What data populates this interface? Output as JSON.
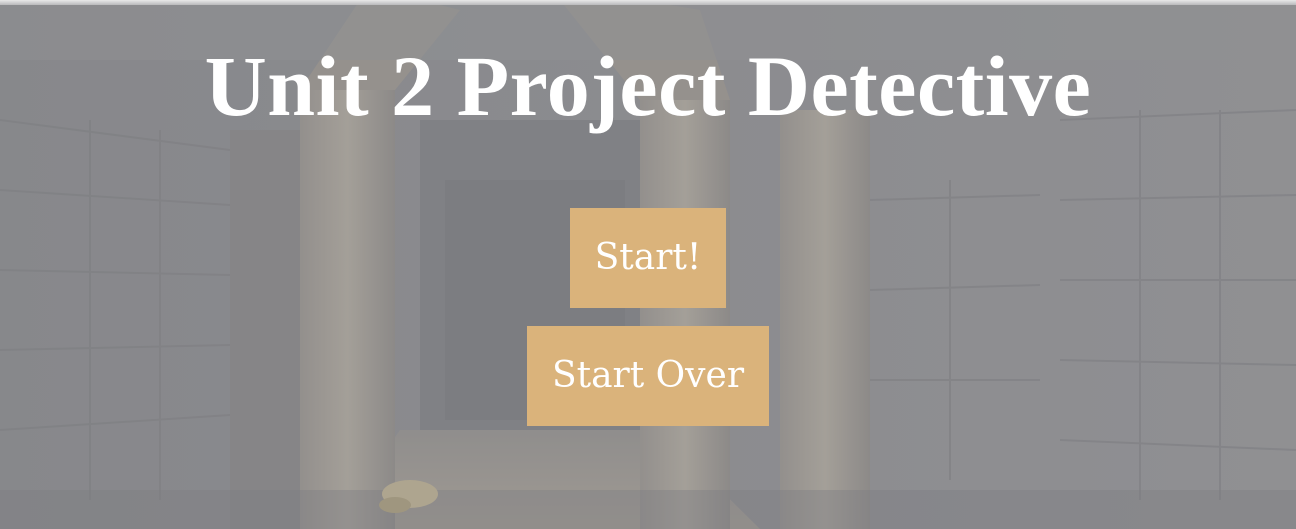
{
  "title": "Unit 2 Project Detective",
  "buttons": {
    "start_label": "Start!",
    "start_over_label": "Start Over"
  },
  "background": {
    "description_icon": "dungeon-corridor-background",
    "button_color": "#dab37b",
    "text_color": "#ffffff"
  }
}
